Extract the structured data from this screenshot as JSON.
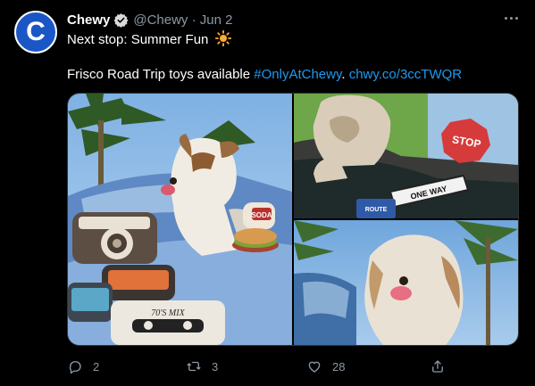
{
  "tweet": {
    "avatar_letter": "C",
    "author_name": "Chewy",
    "handle_date": "@Chewy · Jun 2",
    "text_line1": "Next stop: Summer Fun",
    "text_line2_prefix": "Frisco Road Trip toys available ",
    "hashtag": "#OnlyAtChewy",
    "text_line2_mid": ". ",
    "url": "chwy.co/3ccTWQR"
  },
  "media": {
    "sign_stop": "STOP",
    "sign_one_way": "ONE WAY",
    "sign_route": "ROUTE",
    "toy_soda": "SODA",
    "toy_cassette": "70'S MIX"
  },
  "actions": {
    "reply_count": "2",
    "retweet_count": "3",
    "like_count": "28"
  },
  "colors": {
    "background": "#000000",
    "accent_link": "#1d9bf0",
    "muted": "#8b98a5",
    "avatar_bg": "#1a56c6"
  },
  "icons": [
    "verified-badge-icon",
    "more-icon",
    "sun-emoji-icon",
    "reply-icon",
    "retweet-icon",
    "like-icon",
    "share-icon"
  ]
}
